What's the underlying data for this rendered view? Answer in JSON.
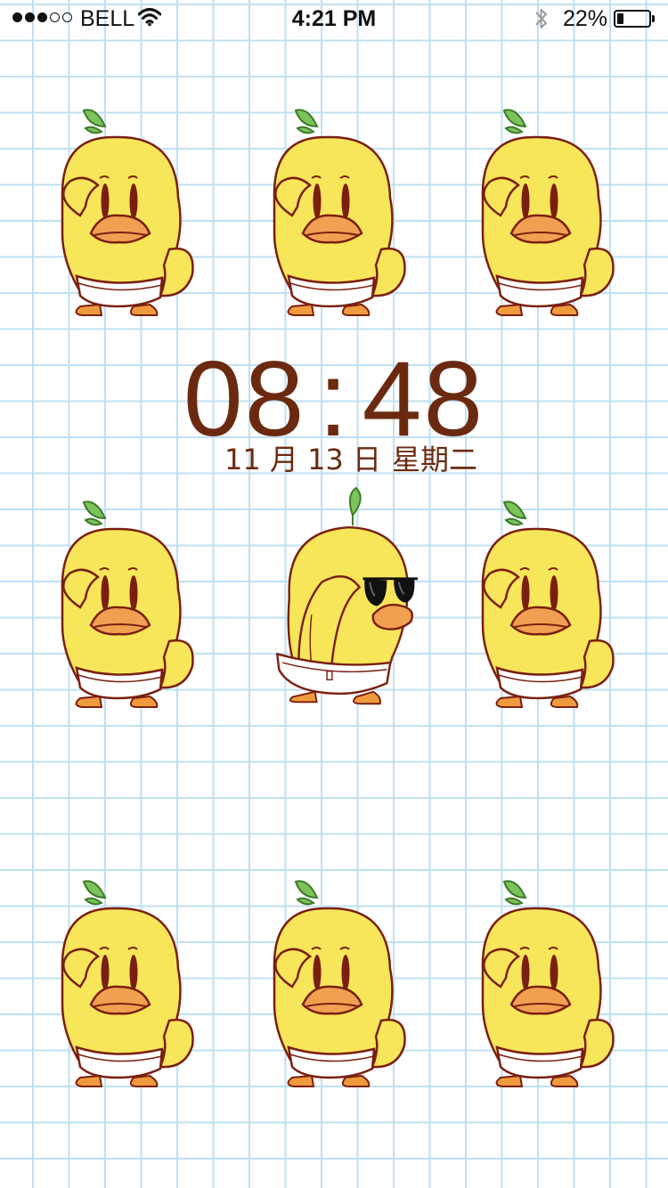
{
  "status_bar": {
    "carrier": "BELL",
    "time": "4:21 PM",
    "battery_percent": "22%",
    "battery_level": 0.22,
    "signal_bars_filled": 3,
    "signal_bars_total": 5,
    "wifi_icon": "wifi-icon",
    "bluetooth_icon": "bluetooth-icon"
  },
  "lockscreen": {
    "clock_hours": "08",
    "clock_separator": ":",
    "clock_minutes": "48",
    "date": "11 月 13 日",
    "weekday": "星期二"
  },
  "wallpaper": {
    "pattern": "grid-paper",
    "grid_color": "#bfe0f3",
    "text_color": "#6b2a10",
    "duck_body_color": "#f8e65a",
    "duck_outline_color": "#7a1f10",
    "duck_beak_color": "#f0a050",
    "leaf_color": "#7cc35a",
    "icons": [
      "duck-saluting-icon",
      "duck-sunglasses-icon"
    ]
  }
}
